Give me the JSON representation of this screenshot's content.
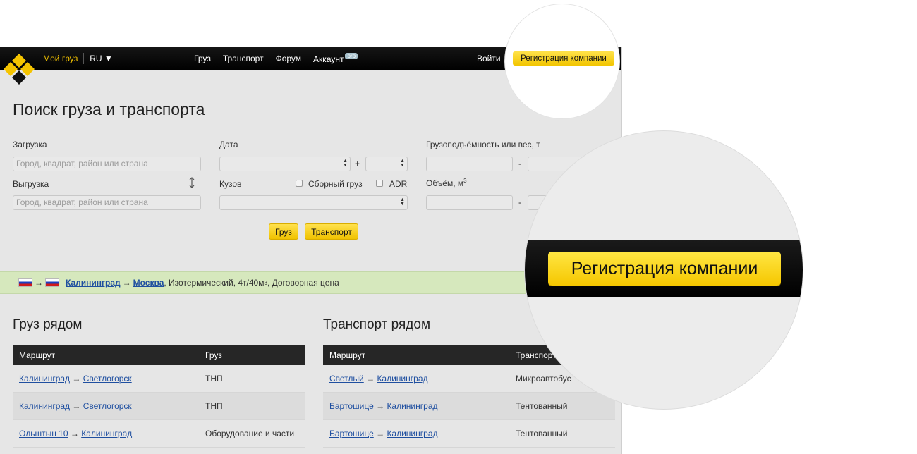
{
  "header": {
    "brand": "Мой груз",
    "language": "RU ▼",
    "nav": [
      "Груз",
      "Транспорт",
      "Форум",
      "Аккаунт"
    ],
    "pro_badge": "pro",
    "login": "Войти",
    "register": "Регистрация компании"
  },
  "search": {
    "title": "Поиск груза и транспорта",
    "loading_label": "Загрузка",
    "loading_placeholder": "Город, квадрат, район или страна",
    "unloading_label": "Выгрузка",
    "unloading_placeholder": "Город, квадрат, район или страна",
    "date_label": "Дата",
    "plus": "+",
    "body_label": "Кузов",
    "combined_label": "Сборный груз",
    "adr_label": "ADR",
    "capacity_label": "Грузоподъёмность или вес, т",
    "volume_label": "Объём, м",
    "volume_sup": "3",
    "dash": "-",
    "cargo_button": "Груз",
    "transport_button": "Транспорт"
  },
  "promo": {
    "from": "Калининград",
    "to": "Москва",
    "details": ", Изотермический, 4т/40м",
    "sup": "3",
    "details2": ", Договорная цена"
  },
  "cargo_near": {
    "title": "Груз рядом",
    "col_route": "Маршрут",
    "col_cargo": "Груз",
    "rows": [
      {
        "from": "Калининград",
        "to": "Светлогорск",
        "cargo": "ТНП"
      },
      {
        "from": "Калининград",
        "to": "Светлогорск",
        "cargo": "ТНП"
      },
      {
        "from": "Ольштын 10",
        "to": "Калининград",
        "cargo": "Оборудование и части"
      }
    ]
  },
  "transport_near": {
    "title": "Транспорт рядом",
    "col_route": "Маршрут",
    "col_transport": "Транспорт",
    "rows": [
      {
        "from": "Светлый",
        "to": "Калининград",
        "transport": "Микроавтобус"
      },
      {
        "from": "Бартошице",
        "to": "Калининград",
        "transport": "Тентованный"
      },
      {
        "from": "Бартошице",
        "to": "Калининград",
        "transport": "Тентованный"
      }
    ]
  },
  "magnifier": {
    "register": "Регистрация компании"
  },
  "arrow": "→",
  "colors": {
    "accent": "#f5c400",
    "header": "#000000",
    "link": "#1f4fa0",
    "promo_bg": "#d6e8bd"
  }
}
